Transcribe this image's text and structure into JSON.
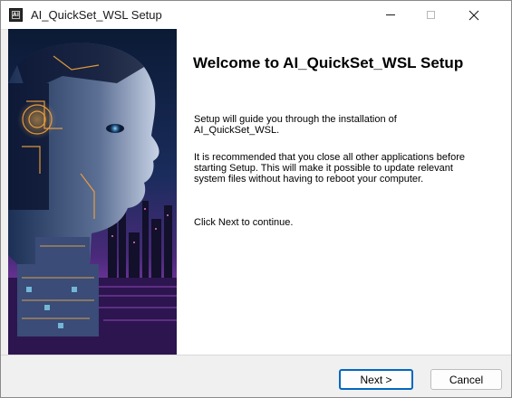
{
  "window": {
    "title": "AI_QuickSet_WSL Setup",
    "icon": "app-installer-icon",
    "controls": {
      "minimize": "minimize-icon",
      "maximize": "maximize-icon",
      "close_glyph": "✕"
    }
  },
  "banner": {
    "description_icon": "ai-cyborg-head-illustration"
  },
  "content": {
    "title": "Welcome to AI_QuickSet_WSL Setup",
    "paragraph_1": "Setup will guide you through the installation of AI_QuickSet_WSL.",
    "paragraph_2": "It is recommended that you close all other applications before starting Setup. This will make it possible to update relevant system files without having to reboot your computer.",
    "paragraph_3": "Click Next to continue."
  },
  "buttons": {
    "next_label": "Next >",
    "cancel_label": "Cancel"
  },
  "colors": {
    "accent": "#0067c0",
    "background": "#f0f0f0"
  }
}
